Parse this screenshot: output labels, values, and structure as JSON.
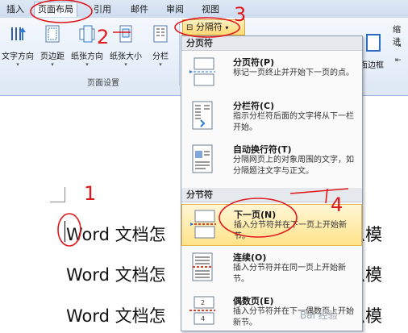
{
  "ribbon": {
    "tabs": [
      "插入",
      "页面布局",
      "引用",
      "邮件",
      "审阅",
      "视图"
    ],
    "active_tab": "页面布局",
    "buttons": [
      {
        "label": "文字方向",
        "icon": "text-direction-icon"
      },
      {
        "label": "页边距",
        "icon": "margins-icon"
      },
      {
        "label": "纸张方向",
        "icon": "orientation-icon"
      },
      {
        "label": "纸张大小",
        "icon": "size-icon"
      },
      {
        "label": "分栏",
        "icon": "columns-icon"
      }
    ],
    "group_label": "页面设置",
    "breaks_button": "分隔符",
    "right_button": "页面边框",
    "right_indent": "缩进"
  },
  "menu": {
    "section1": "分页符",
    "section2": "分节符",
    "items": [
      {
        "title": "分页符(P)",
        "desc": "标记一页终止并开始下一页的点。"
      },
      {
        "title": "分栏符(C)",
        "desc": "指示分栏符后面的文字将从下一栏开始。"
      },
      {
        "title": "自动换行符(T)",
        "desc": "分隔网页上的对象周围的文字，如分隔题注文字与正文。"
      },
      {
        "title": "下一页(N)",
        "desc": "插入分节符并在下一页上开始新节。"
      },
      {
        "title": "连续(O)",
        "desc": "插入分节符并在同一页上开始新节。"
      },
      {
        "title": "偶数页(E)",
        "desc": "插入分节符并在下一偶数页上开始新节。"
      }
    ]
  },
  "document": {
    "lines": [
      "Word 文档怎",
      "Word 文档怎",
      "Word 文档怎"
    ],
    "right_fragment": "么模"
  },
  "annotations": [
    "1",
    "2",
    "3",
    "4"
  ],
  "watermark": "Bai 经验"
}
